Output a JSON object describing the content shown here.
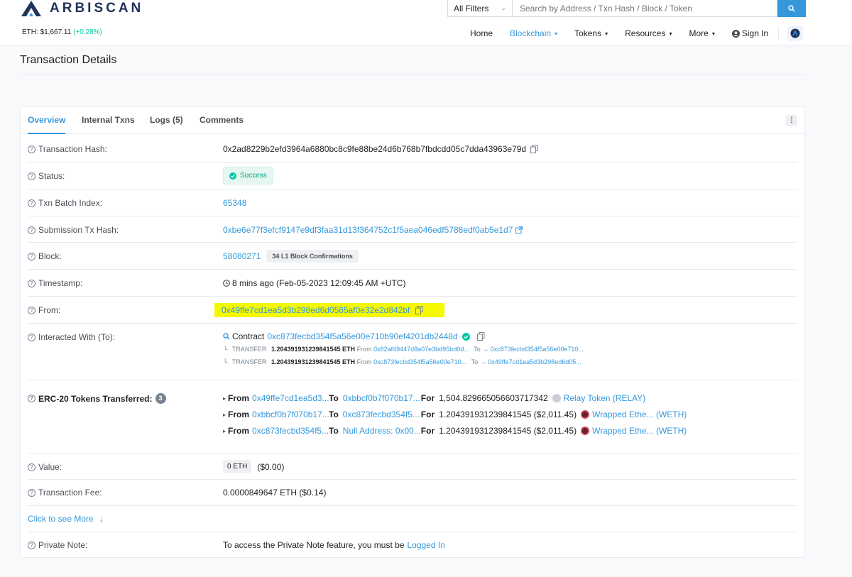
{
  "header": {
    "brand": "ARBISCAN",
    "eth_price_label": "ETH: $1,667.11",
    "eth_price_change": "(+0.28%)",
    "filter_label": "All Filters",
    "search_placeholder": "Search by Address / Txn Hash / Block / Token",
    "nav": {
      "home": "Home",
      "blockchain": "Blockchain",
      "tokens": "Tokens",
      "resources": "Resources",
      "more": "More",
      "sign_in": "Sign In"
    }
  },
  "page": {
    "title": "Transaction Details"
  },
  "tabs": {
    "overview": "Overview",
    "internal": "Internal Txns",
    "logs": "Logs (5)",
    "comments": "Comments",
    "more": "⋮"
  },
  "details": {
    "tx_hash": {
      "label": "Transaction Hash:",
      "value": "0x2ad8229b2efd3964a6880bc8c9fe88be24d6b768b7fbdcdd05c7dda43963e79d"
    },
    "status": {
      "label": "Status:",
      "value": "Success"
    },
    "batch": {
      "label": "Txn Batch Index:",
      "value": "65348"
    },
    "submission": {
      "label": "Submission Tx Hash:",
      "value": "0xbe6e77f3efcf9147e9df3faa31d13f364752c1f5aea046edf5788edf0ab5e1d7"
    },
    "block": {
      "label": "Block:",
      "value": "58080271",
      "confirmations": "34 L1 Block Confirmations"
    },
    "timestamp": {
      "label": "Timestamp:",
      "value": "8 mins ago (Feb-05-2023 12:09:45 AM +UTC)"
    },
    "from": {
      "label": "From:",
      "value": "0x49ffe7cd1ea5d3b298ed6d0585af0e32e2d842bf"
    },
    "interacted": {
      "label": "Interacted With (To):",
      "prefix": "Contract",
      "contract": "0xc873fecbd354f5a56e00e710b90ef4201db2448d",
      "transfers": [
        {
          "tag": "TRANSFER",
          "amount": "1.204391931239841545 ETH",
          "from_label": "From",
          "from": "0x82af49447d8a07e3bd95bd0d...",
          "to_label": "To",
          "to": "0xc873fecbd354f5a56e00e710..."
        },
        {
          "tag": "TRANSFER",
          "amount": "1.204391931239841545 ETH",
          "from_label": "From",
          "from": "0xc873fecbd354f5a56e00e710...",
          "to_label": "To",
          "to": "0x49ffe7cd1ea5d3b298ed6d05..."
        }
      ]
    },
    "erc20": {
      "label": "ERC-20 Tokens Transferred:",
      "count": "3",
      "rows": [
        {
          "from_label": "From",
          "from": "0x49ffe7cd1ea5d3...",
          "to_label": "To",
          "to": "0xbbcf0b7f070b17...",
          "for_label": "For",
          "amount": "1,504.829665056603717342",
          "token": "Relay Token (RELAY)"
        },
        {
          "from_label": "From",
          "from": "0xbbcf0b7f070b17...",
          "to_label": "To",
          "to": "0xc873fecbd354f5...",
          "for_label": "For",
          "amount": "1.204391931239841545 ($2,011.45)",
          "token": "Wrapped Ethe... (WETH)"
        },
        {
          "from_label": "From",
          "from": "0xc873fecbd354f5...",
          "to_label": "To",
          "to": "Null Address: 0x00...",
          "for_label": "For",
          "amount": "1.204391931239841545 ($2,011.45)",
          "token": "Wrapped Ethe... (WETH)"
        }
      ]
    },
    "value": {
      "label": "Value:",
      "eth": "0 ETH",
      "usd": "($0.00)"
    },
    "fee": {
      "label": "Transaction Fee:",
      "value": "0.0000849647 ETH ($0.14)"
    },
    "see_more": "Click to see More",
    "private_note": {
      "label": "Private Note:",
      "text": "To access the Private Note feature, you must be",
      "link": "Logged In"
    }
  },
  "colors": {
    "accent": "#3498db",
    "success": "#00c9a7",
    "highlight": "#f4f900"
  }
}
